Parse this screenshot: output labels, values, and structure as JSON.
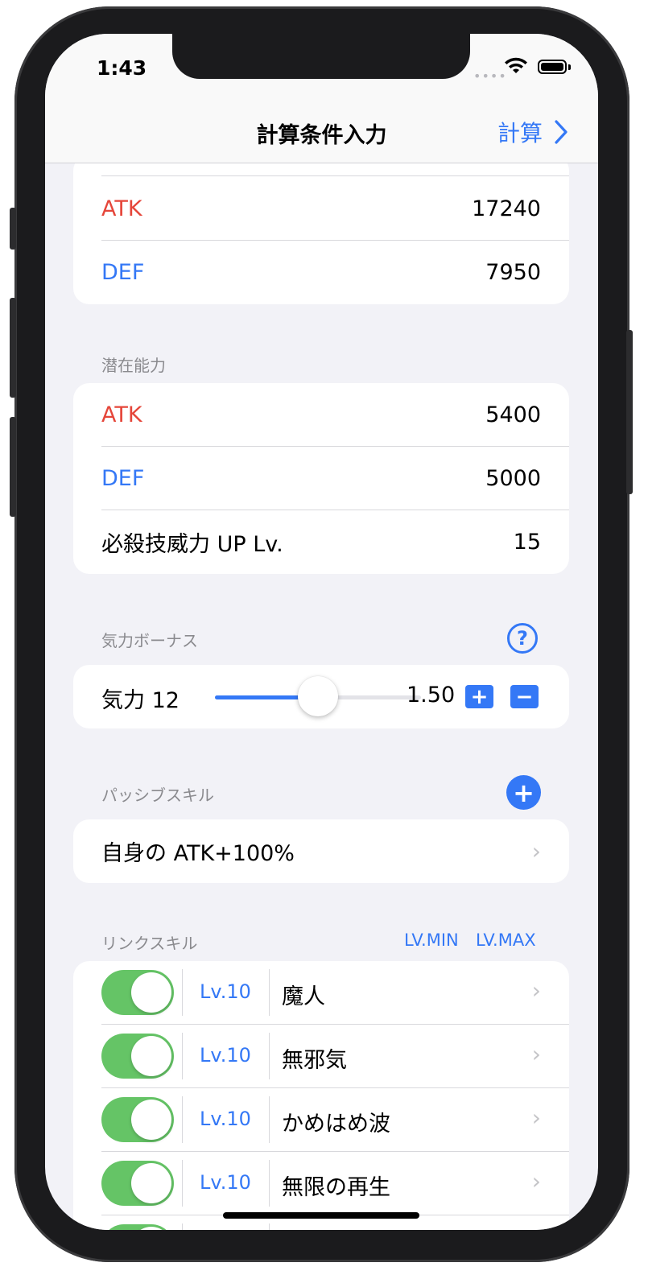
{
  "status_bar": {
    "time": "1:43",
    "signal": "••••"
  },
  "nav": {
    "title": "計算条件入力",
    "action_label": "計算"
  },
  "stats_card": [
    {
      "label": "ATK",
      "value": "17240"
    },
    {
      "label": "DEF",
      "value": "7950"
    }
  ],
  "potential": {
    "header": "潜在能力",
    "rows": [
      {
        "label": "ATK",
        "value": "5400"
      },
      {
        "label": "DEF",
        "value": "5000"
      },
      {
        "label": "必殺技威力 UP Lv.",
        "value": "15"
      }
    ]
  },
  "ki_bonus": {
    "header": "気力ボーナス",
    "help_icon": "?",
    "label": "気力 12",
    "value": "1.50",
    "slider_fraction": 0.5,
    "plus": "+",
    "minus": "−"
  },
  "passive": {
    "header": "パッシブスキル",
    "add_icon": "+",
    "item": "自身の ATK+100%"
  },
  "link_skills": {
    "header": "リンクスキル",
    "lv_min": "LV.MIN",
    "lv_max": "LV.MAX",
    "items": [
      {
        "level": "Lv.10",
        "name": "魔人",
        "enabled": true
      },
      {
        "level": "Lv.10",
        "name": "無邪気",
        "enabled": true
      },
      {
        "level": "Lv.10",
        "name": "かめはめ波",
        "enabled": true
      },
      {
        "level": "Lv.10",
        "name": "無限の再生",
        "enabled": true
      }
    ]
  },
  "colors": {
    "accent": "#3478f6",
    "atk": "#e5463a",
    "toggle_on": "#65c466"
  },
  "icons": {
    "chevron": "›",
    "nav_chevron": "chevron-right-icon"
  }
}
